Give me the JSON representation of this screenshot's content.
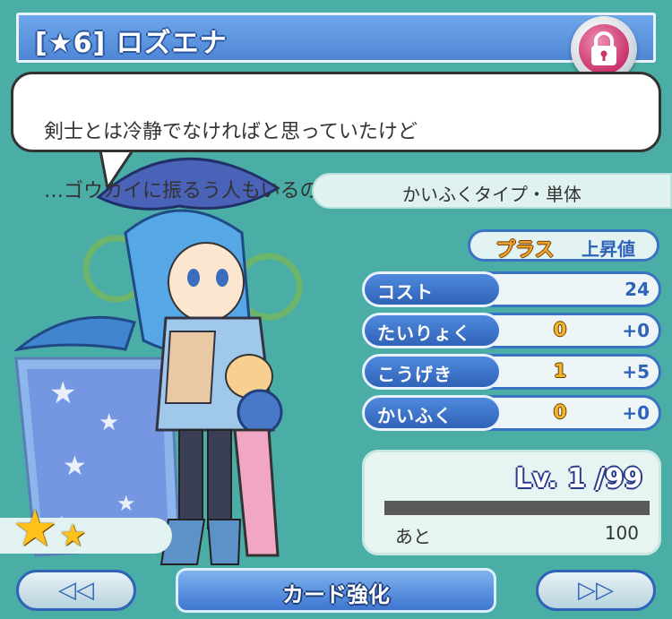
{
  "card": {
    "title": "[★6] ロズエナ",
    "quote_line1": "剣士とは冷静でなければと思っていたけど",
    "quote_line2": "…ゴウカイに振るう人もいるのね"
  },
  "type": {
    "label": "かいふくタイプ・単体"
  },
  "stats_header": {
    "plus_label": "プラス",
    "rise_label": "上昇値"
  },
  "stats": [
    {
      "label": "コスト",
      "base": "",
      "plus": "24"
    },
    {
      "label": "たいりょく",
      "base": "0",
      "plus": "+0"
    },
    {
      "label": "こうげき",
      "base": "1",
      "plus": "+5"
    },
    {
      "label": "かいふく",
      "base": "0",
      "plus": "+0"
    }
  ],
  "level": {
    "text": "Lv. 1 /99",
    "remaining_label": "あと",
    "remaining_value": "100",
    "exp_progress": 0
  },
  "buttons": {
    "prev_symbol": "◁◁",
    "next_symbol": "▷▷",
    "enhance_label": "カード強化"
  },
  "rarity_stars": {
    "big": "★",
    "small": "★"
  },
  "icons": {
    "lock": "padlock-icon",
    "prev": "double-left-arrow-icon",
    "next": "double-right-arrow-icon"
  },
  "colors": {
    "background": "#4aaea6",
    "title_bar": "#5b93df",
    "accent_blue": "#2f63b8",
    "plus_orange": "#f0a22a",
    "star_gold": "#ffc21a"
  }
}
